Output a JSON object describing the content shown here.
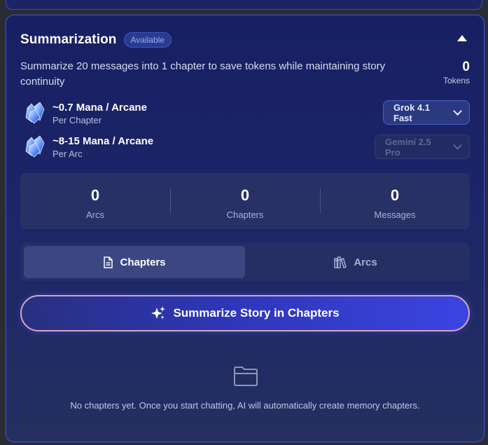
{
  "section": {
    "title": "Summarization",
    "badge": "Available",
    "description": "Summarize 20 messages into 1 chapter to save tokens while maintaining story continuity",
    "tokens": {
      "value": "0",
      "label": "Tokens"
    }
  },
  "costs": [
    {
      "cost": "~0.7 Mana / Arcane",
      "unit": "Per Chapter",
      "model": "Grok 4.1 Fast",
      "model_enabled": true
    },
    {
      "cost": "~8-15 Mana / Arcane",
      "unit": "Per Arc",
      "model": "Gemini 2.5 Pro",
      "model_enabled": false
    }
  ],
  "stats": [
    {
      "value": "0",
      "label": "Arcs"
    },
    {
      "value": "0",
      "label": "Chapters"
    },
    {
      "value": "0",
      "label": "Messages"
    }
  ],
  "tabs": [
    {
      "label": "Chapters",
      "icon": "document-icon",
      "active": true
    },
    {
      "label": "Arcs",
      "icon": "books-icon",
      "active": false
    }
  ],
  "action": {
    "label": "Summarize Story in Chapters",
    "icon": "sparkles-icon"
  },
  "empty_state": {
    "icon": "folder-icon",
    "message": "No chapters yet. Once you start chatting, AI will automatically create memory chapters."
  },
  "colors": {
    "accent": "#3b44e0",
    "panel_border": "#3a4fd6",
    "badge_text": "#8fb0ff"
  }
}
